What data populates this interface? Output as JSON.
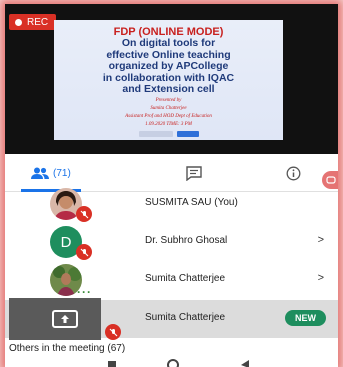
{
  "recording": {
    "label": "REC",
    "color": "#d93025"
  },
  "slide": {
    "line1": "FDP (ONLINE MODE)",
    "line2": "On digital tools for",
    "line3": "effective Online teaching",
    "line4": "organized by APCollege",
    "line5": "in collaboration with IQAC",
    "line6": "and Extension cell",
    "presented_by": "Presented by",
    "presenter": "Sumita Chatterjee",
    "designation": "Assistant Prof and HOD Dept of Education",
    "datetime": "1.09.2020 TIME: 3 PM"
  },
  "tabs": {
    "people_label": "(71)",
    "people_icon": "people-icon",
    "chat_icon": "chat-icon",
    "info_icon": "info-icon",
    "active_color": "#1a73e8"
  },
  "participants": [
    {
      "name": "SUSMITA SAU (You)",
      "muted": true,
      "has_chevron": false
    },
    {
      "name": "Dr. Subhro Ghosal",
      "initial": "D",
      "muted": true,
      "has_chevron": true,
      "chevron": ">"
    },
    {
      "name": "Sumita Chatterjee",
      "speaking": true,
      "has_chevron": true,
      "chevron": ">"
    },
    {
      "name": "Sumita Chatterjee",
      "presenting": true,
      "badge": "NEW",
      "muted": true
    }
  ],
  "others_label": "Others in the meeting (67)",
  "colors": {
    "new_badge": "#1e8e5e",
    "avatar_d": "#1e8e5e",
    "mute_badge": "#d93025"
  }
}
